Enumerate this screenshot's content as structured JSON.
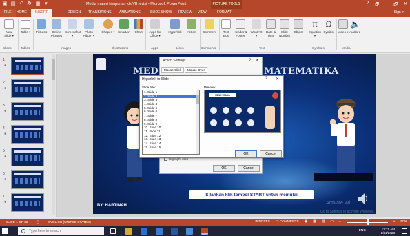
{
  "window": {
    "title": "Media materi himpunan kls VII revisi - Microsoft PowerPoint",
    "contextual_tab": "PICTURE TOOLS",
    "controls": [
      "?",
      "🗗",
      "–",
      "🗗",
      "✕"
    ]
  },
  "tabs": [
    {
      "label": "FILE"
    },
    {
      "label": "HOME"
    },
    {
      "label": "INSERT"
    },
    {
      "label": "DESIGN"
    },
    {
      "label": "TRANSITIONS"
    },
    {
      "label": "ANIMATIONS"
    },
    {
      "label": "SLIDE SHOW"
    },
    {
      "label": "REVIEW"
    },
    {
      "label": "VIEW"
    },
    {
      "label": "FORMAT"
    }
  ],
  "signin": "Sign in",
  "ribbon": {
    "buttons": [
      {
        "label": "New Slide ▾"
      },
      {
        "label": "Table ▾"
      },
      {
        "label": "Pictures"
      },
      {
        "label": "Online Pictures"
      },
      {
        "label": "Screenshot ▾"
      },
      {
        "label": "Photo Album ▾"
      },
      {
        "label": "Shapes ▾"
      },
      {
        "label": "SmartArt"
      },
      {
        "label": "Chart"
      },
      {
        "label": "Apps for Office ▾"
      },
      {
        "label": "Hyperlink"
      },
      {
        "label": "Action"
      },
      {
        "label": "Comment"
      },
      {
        "label": "Text Box"
      },
      {
        "label": "Header & Footer"
      },
      {
        "label": "WordArt ▾"
      },
      {
        "label": "Date & Time"
      },
      {
        "label": "Slide Number"
      },
      {
        "label": "Object"
      },
      {
        "label": "Equation ▾"
      },
      {
        "label": "Symbol"
      },
      {
        "label": "Video ▾"
      },
      {
        "label": "Audio ▾"
      }
    ],
    "groups": [
      "Slides",
      "Tables",
      "Images",
      "Illustrations",
      "Apps",
      "Links",
      "Comments",
      "Text",
      "Symbols",
      "Media"
    ]
  },
  "slide": {
    "heading_left": "MED",
    "heading_right": "MATEMATIKA",
    "author": "BY: HARTINAH",
    "start_text": "Silahkan klik tombol START untuk memulai",
    "watermark_1": "Activate Wi",
    "watermark_2": "Go to Settings to activate Windows."
  },
  "action_dialog": {
    "title": "Action Settings",
    "help": "?",
    "close": "✕",
    "tabs": [
      "Mouse Click",
      "Mouse Over"
    ],
    "highlight_label": "Highlight click",
    "ok": "OK",
    "cancel": "Cancel"
  },
  "hyperlink_dialog": {
    "title": "Hyperlink to Slide",
    "help": "?",
    "close": "✕",
    "slide_title_label": "Slide title:",
    "preview_label": "Preview",
    "slides": [
      "1. Slide 1",
      "2. Slide 2",
      "3. Slide 3",
      "4. Slide 4",
      "5. Slide 5",
      "6. Slide 6",
      "7. Slide 7",
      "8. Slide 8",
      "9. Slide 9",
      "10. Slide 10",
      "11. Slide 11",
      "12. Slide 12",
      "13. Slide 13",
      "14. Slide 14",
      "15. Slide 15"
    ],
    "selected_index": 1,
    "preview_banner": "MENU UTAMA",
    "ok": "OK",
    "cancel": "Cancel"
  },
  "thumbnails": [
    {
      "num": "1"
    },
    {
      "num": "2"
    },
    {
      "num": "3"
    },
    {
      "num": "4"
    },
    {
      "num": "5"
    },
    {
      "num": "6"
    },
    {
      "num": "7"
    }
  ],
  "status": {
    "slide_info": "SLIDE 1 OF 32",
    "language": "ENGLISH (UNITED STATES)",
    "notes": "NOTES",
    "comments": "COMMENTS",
    "zoom": "50%"
  },
  "taskbar": {
    "search_placeholder": "Type here to search",
    "lang": "ENG",
    "time": "12:21 AM",
    "date": "1/21/2023"
  },
  "colors": {
    "accent": "#b7472a",
    "slide_bg": "#0b2f78",
    "selection": "#3b78d8"
  }
}
